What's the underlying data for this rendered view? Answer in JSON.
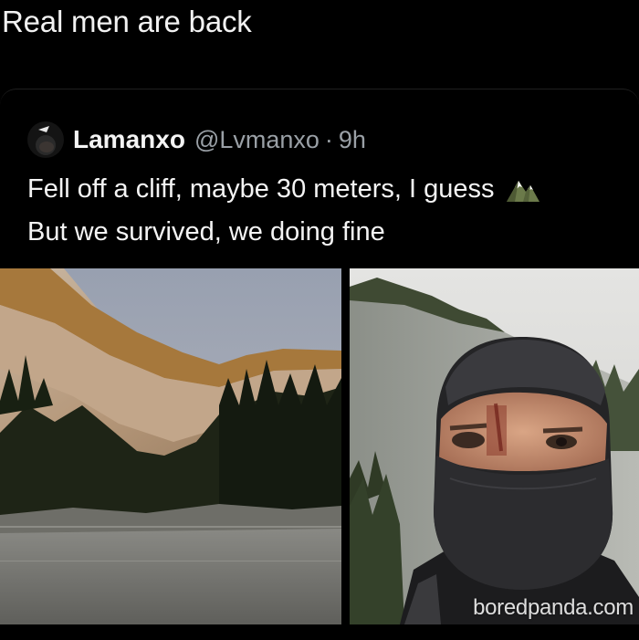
{
  "caption": "Real men are back",
  "tweet": {
    "display_name": "Lamanxo",
    "handle": "@Lvmanxo",
    "separator": "·",
    "timestamp": "9h",
    "lines": [
      "Fell off a cliff, maybe 30 meters, I guess",
      "But we survived, we doing fine"
    ],
    "emoji": "mountain-snow-icon"
  },
  "images": [
    {
      "name": "cliff-valley-photo"
    },
    {
      "name": "masked-selfie-photo"
    }
  ],
  "watermark": "boredpanda.com",
  "colors": {
    "background": "#000000",
    "text": "#f4f4f4",
    "muted": "#9aa0a6"
  }
}
